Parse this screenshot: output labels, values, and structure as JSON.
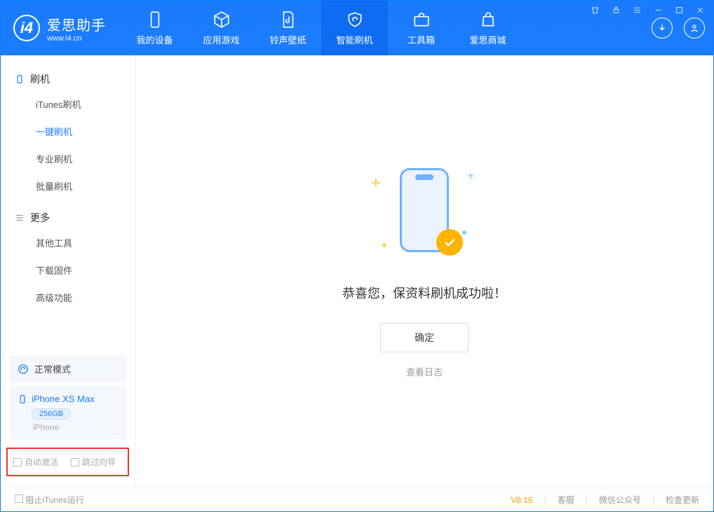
{
  "app": {
    "name_zh": "爱思助手",
    "site": "www.i4.cn"
  },
  "nav": {
    "my_device": "我的设备",
    "apps_games": "应用游戏",
    "ring_wall": "铃声壁纸",
    "smart_flash": "智能刷机",
    "toolbox": "工具箱",
    "store": "爱思商城"
  },
  "sidebar": {
    "flash_title": "刷机",
    "flash_items": [
      "iTunes刷机",
      "一键刷机",
      "专业刷机",
      "批量刷机"
    ],
    "more_title": "更多",
    "more_items": [
      "其他工具",
      "下载固件",
      "高级功能"
    ]
  },
  "status": {
    "normal_mode": "正常模式"
  },
  "device": {
    "name": "iPhone XS Max",
    "storage": "256GB",
    "type": "iPhone"
  },
  "options": {
    "auto_activate": "自动激活",
    "skip_guide": "跳过向导"
  },
  "main": {
    "success": "恭喜您，保资料刷机成功啦！",
    "ok": "确定",
    "view_log": "查看日志"
  },
  "footer": {
    "block_itunes": "阻止iTunes运行",
    "version": "V8.16",
    "service": "客服",
    "wechat": "微信公众号",
    "update": "检查更新"
  }
}
